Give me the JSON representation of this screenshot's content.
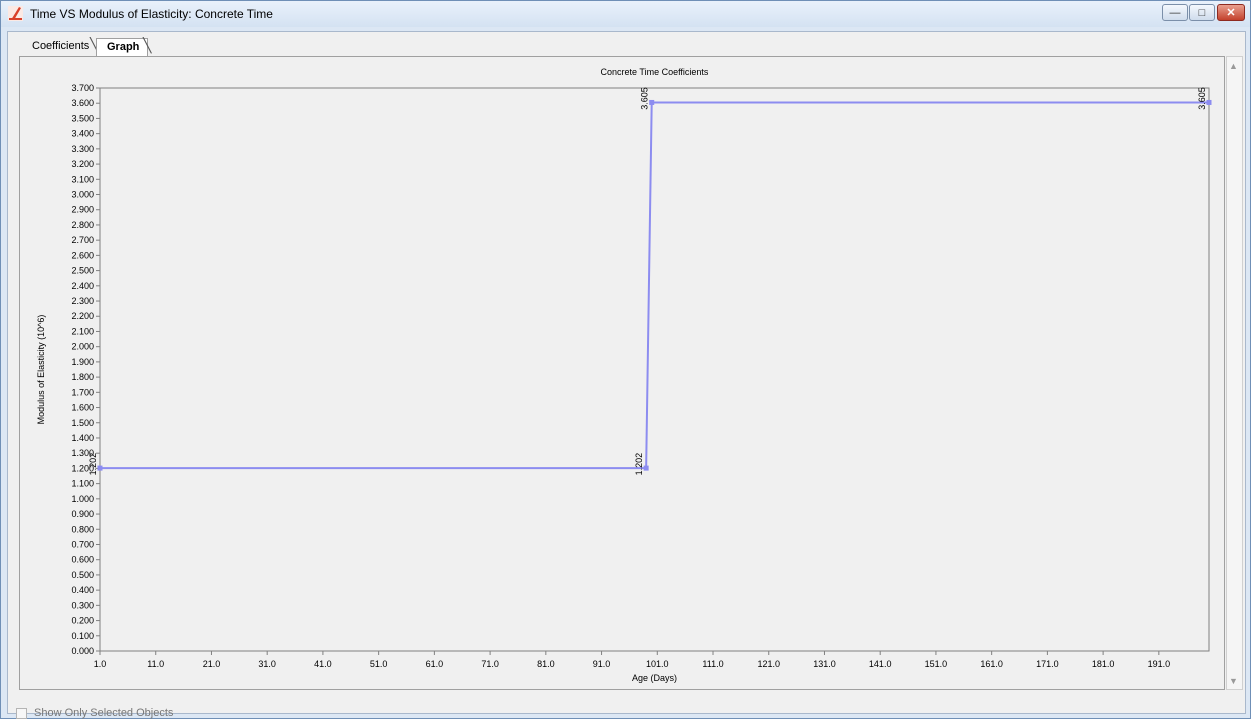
{
  "window": {
    "title": "Time VS Modulus of Elasticity: Concrete Time",
    "minimize_label": "—",
    "maximize_label": "□",
    "close_label": "✕"
  },
  "tabs": [
    {
      "label": "Coefficients",
      "active": false
    },
    {
      "label": "Graph",
      "active": true
    }
  ],
  "footer": {
    "checkbox_label": "Show Only Selected Objects",
    "checked": false
  },
  "colors": {
    "series": "#8c8cf0",
    "accent": "#d9402a"
  },
  "chart_data": {
    "type": "line",
    "title": "Concrete Time Coefficients",
    "xlabel": "Age (Days)",
    "ylabel": "Modulus of Elasticity (10^6)",
    "xlim": [
      1,
      200
    ],
    "ylim": [
      0,
      3.7
    ],
    "xticks": [
      "1.0",
      "11.0",
      "21.0",
      "31.0",
      "41.0",
      "51.0",
      "61.0",
      "71.0",
      "81.0",
      "91.0",
      "101.0",
      "111.0",
      "121.0",
      "131.0",
      "141.0",
      "151.0",
      "161.0",
      "171.0",
      "181.0",
      "191.0"
    ],
    "yticks": [
      "0.000",
      "0.100",
      "0.200",
      "0.300",
      "0.400",
      "0.500",
      "0.600",
      "0.700",
      "0.800",
      "0.900",
      "1.000",
      "1.100",
      "1.200",
      "1.300",
      "1.400",
      "1.500",
      "1.600",
      "1.700",
      "1.800",
      "1.900",
      "2.000",
      "2.100",
      "2.200",
      "2.300",
      "2.400",
      "2.500",
      "2.600",
      "2.700",
      "2.800",
      "2.900",
      "3.000",
      "3.100",
      "3.200",
      "3.300",
      "3.400",
      "3.500",
      "3.600",
      "3.700"
    ],
    "series": [
      {
        "x": [
          1,
          99,
          100,
          200
        ],
        "y": [
          1.202,
          1.202,
          3.605,
          3.605
        ],
        "labels": [
          "1.202",
          "1.202",
          "3.605",
          "3.605"
        ]
      }
    ],
    "grid": false,
    "legend": "none"
  }
}
